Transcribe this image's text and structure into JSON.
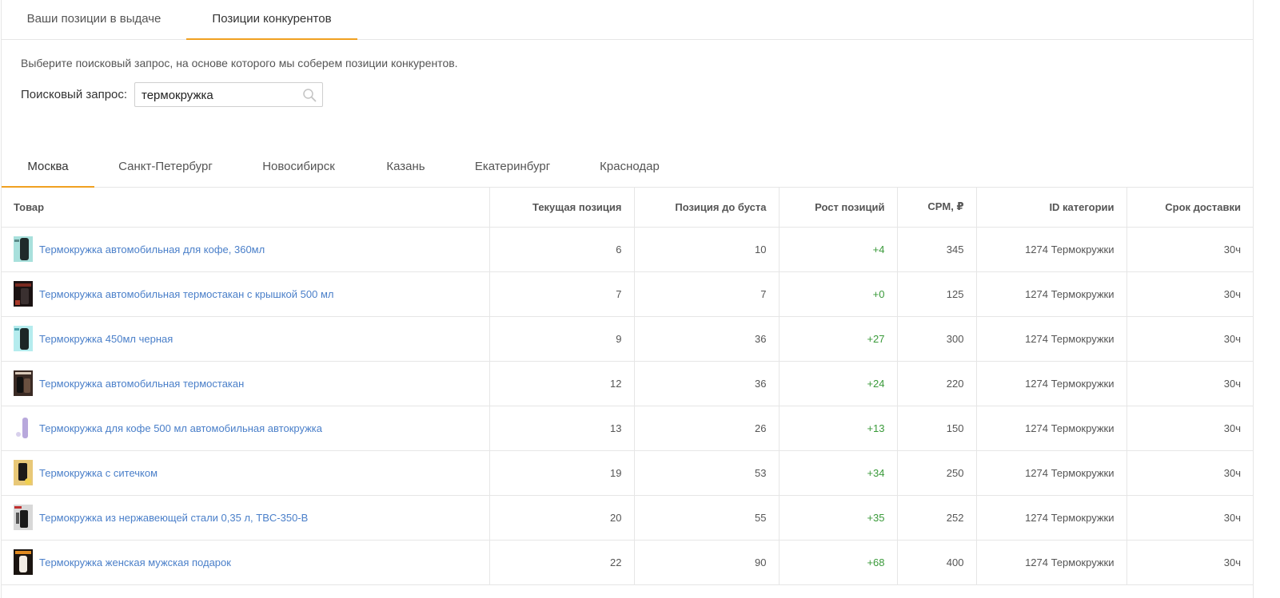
{
  "top_tabs": [
    {
      "label": "Ваши позиции в выдаче",
      "active": false
    },
    {
      "label": "Позиции конкурентов",
      "active": true
    }
  ],
  "hint": "Выберите поисковый запрос, на основе которого мы соберем позиции конкурентов.",
  "search": {
    "label": "Поисковый запрос:",
    "value": "термокружка",
    "icon": "search-icon"
  },
  "city_tabs": [
    {
      "label": "Москва",
      "active": true
    },
    {
      "label": "Санкт-Петербург",
      "active": false
    },
    {
      "label": "Новосибирск",
      "active": false
    },
    {
      "label": "Казань",
      "active": false
    },
    {
      "label": "Екатеринбург",
      "active": false
    },
    {
      "label": "Краснодар",
      "active": false
    }
  ],
  "table": {
    "headers": {
      "product": "Товар",
      "current_position": "Текущая позиция",
      "position_before_boost": "Позиция до буста",
      "position_growth": "Рост позиций",
      "cpm": "CPM, ₽",
      "category_id": "ID категории",
      "delivery_time": "Срок доставки"
    },
    "rows": [
      {
        "product": "Термокружка автомобильная для кофе, 360мл",
        "thumb": "teal-bottle",
        "current": "6",
        "before": "10",
        "growth": "+4",
        "cpm": "345",
        "category": "1274 Термокружки",
        "delivery": "30ч"
      },
      {
        "product": "Термокружка автомобильная термостакан с крышкой 500 мл",
        "thumb": "dark-red",
        "current": "7",
        "before": "7",
        "growth": "+0",
        "cpm": "125",
        "category": "1274 Термокружки",
        "delivery": "30ч"
      },
      {
        "product": "Термокружка 450мл черная",
        "thumb": "teal-bottle",
        "current": "9",
        "before": "36",
        "growth": "+27",
        "cpm": "300",
        "category": "1274 Термокружки",
        "delivery": "30ч"
      },
      {
        "product": "Термокружка автомобильная термостакан",
        "thumb": "dark-brown",
        "current": "12",
        "before": "36",
        "growth": "+24",
        "cpm": "220",
        "category": "1274 Термокружки",
        "delivery": "30ч"
      },
      {
        "product": "Термокружка для кофе 500 мл автомобильная автокружка",
        "thumb": "lavender-bottle",
        "current": "13",
        "before": "26",
        "growth": "+13",
        "cpm": "150",
        "category": "1274 Термокружки",
        "delivery": "30ч"
      },
      {
        "product": "Термокружка с ситечком",
        "thumb": "gold",
        "current": "19",
        "before": "53",
        "growth": "+34",
        "cpm": "250",
        "category": "1274 Термокружки",
        "delivery": "30ч"
      },
      {
        "product": "Термокружка из нержавеющей стали 0,35 л, TBC-350-B",
        "thumb": "grey-dark",
        "current": "20",
        "before": "55",
        "growth": "+35",
        "cpm": "252",
        "category": "1274 Термокружки",
        "delivery": "30ч"
      },
      {
        "product": "Термокружка женская мужская подарок",
        "thumb": "orange-dark",
        "current": "22",
        "before": "90",
        "growth": "+68",
        "cpm": "400",
        "category": "1274 Термокружки",
        "delivery": "30ч"
      }
    ]
  },
  "colors": {
    "accent": "#f0a020",
    "link": "#4a7fc9",
    "growth": "#3a9a3a",
    "border": "#e6e6e6"
  }
}
